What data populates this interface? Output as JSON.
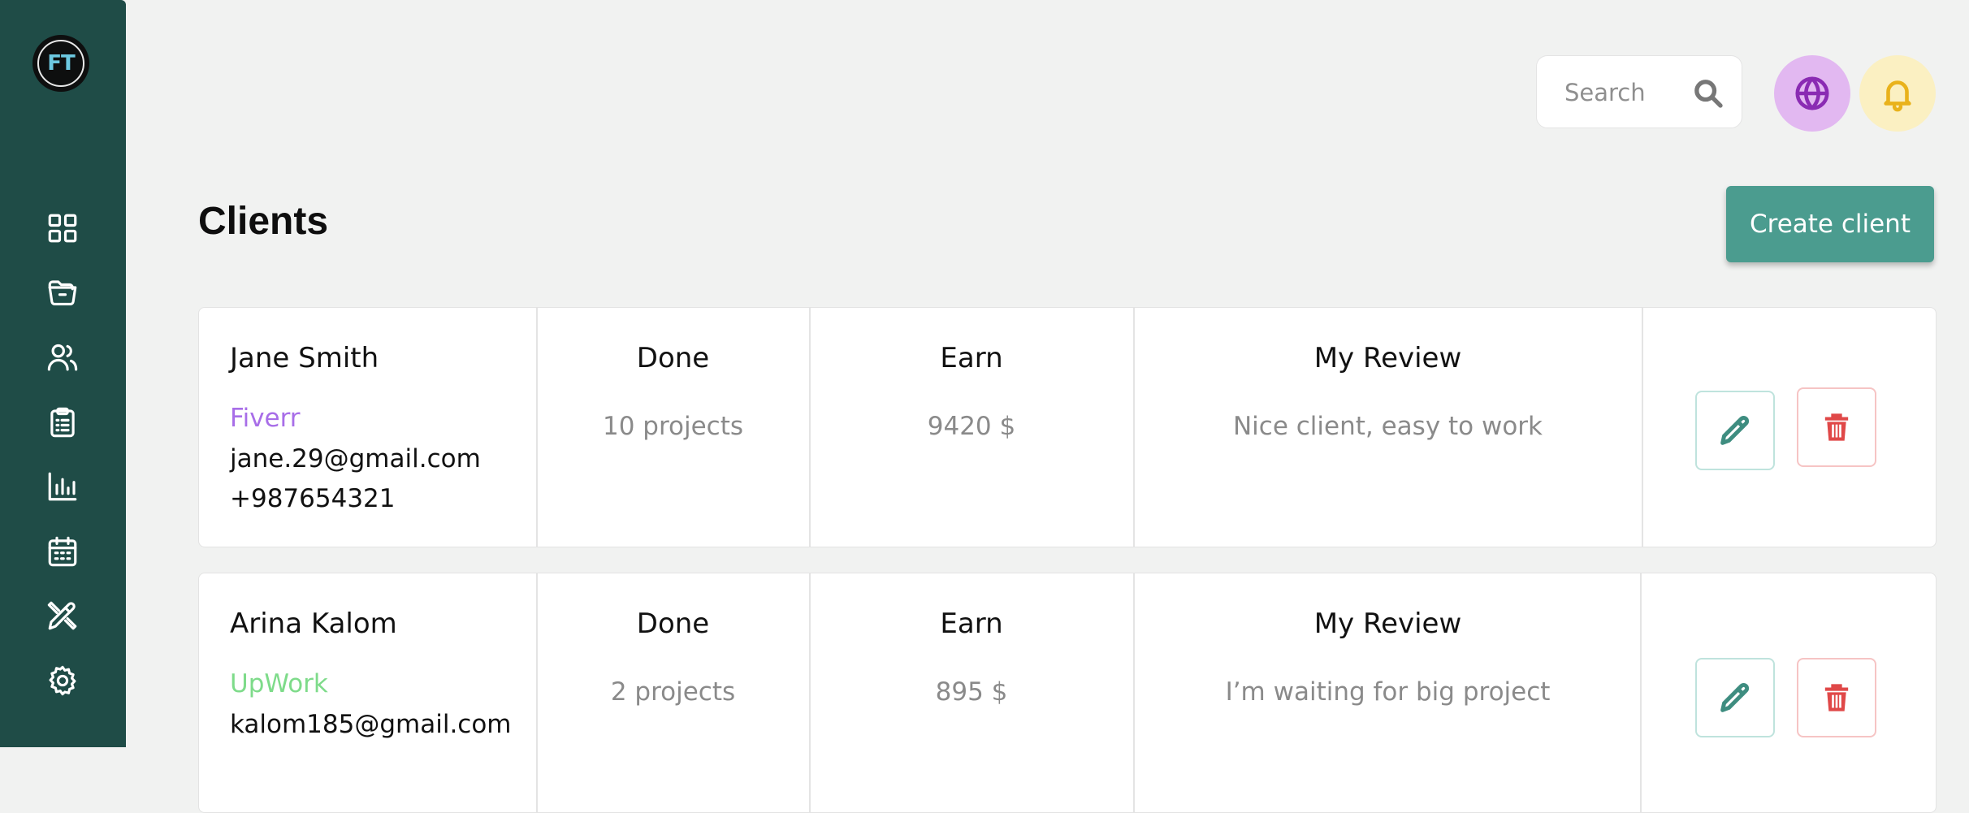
{
  "app": {
    "logo_text": "FT"
  },
  "sidebar": {
    "items": [
      {
        "name": "dashboard",
        "icon": "grid-icon"
      },
      {
        "name": "projects",
        "icon": "folder-icon"
      },
      {
        "name": "clients",
        "icon": "users-icon"
      },
      {
        "name": "tasks",
        "icon": "clipboard-icon"
      },
      {
        "name": "statistics",
        "icon": "bar-chart-icon"
      },
      {
        "name": "calendar",
        "icon": "calendar-icon"
      },
      {
        "name": "design",
        "icon": "pencil-ruler-icon"
      },
      {
        "name": "settings",
        "icon": "gear-icon"
      }
    ]
  },
  "header": {
    "search_placeholder": "Search",
    "search_value": "",
    "globe_icon": "globe-icon",
    "bell_icon": "bell-icon"
  },
  "colors": {
    "sidebar_bg": "#1f4c47",
    "accent": "#4b9c8f",
    "globe_bg": "#e2b8f1",
    "bell_bg": "#fbf0c2",
    "fiverr": "#a86ee8",
    "upwork": "#7edb8a",
    "delete": "#e04848"
  },
  "main": {
    "title": "Clients",
    "create_button": "Create client"
  },
  "columns": {
    "done": "Done",
    "earn": "Earn",
    "review": "My Review"
  },
  "clients": [
    {
      "name": "Jane Smith",
      "platform": "Fiverr",
      "platform_color": "#a86ee8",
      "email": "jane.29@gmail.com",
      "phone": "+987654321",
      "done": "10 projects",
      "earn": "9420 $",
      "review": "Nice client, easy to work"
    },
    {
      "name": "Arina Kalom",
      "platform": "UpWork",
      "platform_color": "#7edb8a",
      "email": "kalom185@gmail.com",
      "done": "2 projects",
      "earn": "895 $",
      "review": "I’m waiting for big project"
    }
  ]
}
